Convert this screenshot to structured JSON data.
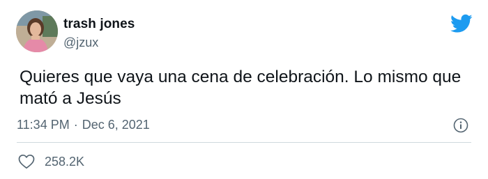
{
  "tweet": {
    "author_name": "trash jones",
    "author_handle": "@jzux",
    "text": "Quieres que vaya una cena de celebración. Lo mismo que mató a Jesús",
    "time": "11:34 PM",
    "separator": "·",
    "date": "Dec 6, 2021",
    "likes": "258.2K"
  },
  "icons": {
    "brand": "twitter-bird-icon",
    "info": "info-icon",
    "like": "heart-icon",
    "avatar": "profile-photo"
  },
  "colors": {
    "brand_blue": "#1d9bf0",
    "text_primary": "#0f1419",
    "text_secondary": "#536471",
    "divider": "#cfd9de"
  }
}
